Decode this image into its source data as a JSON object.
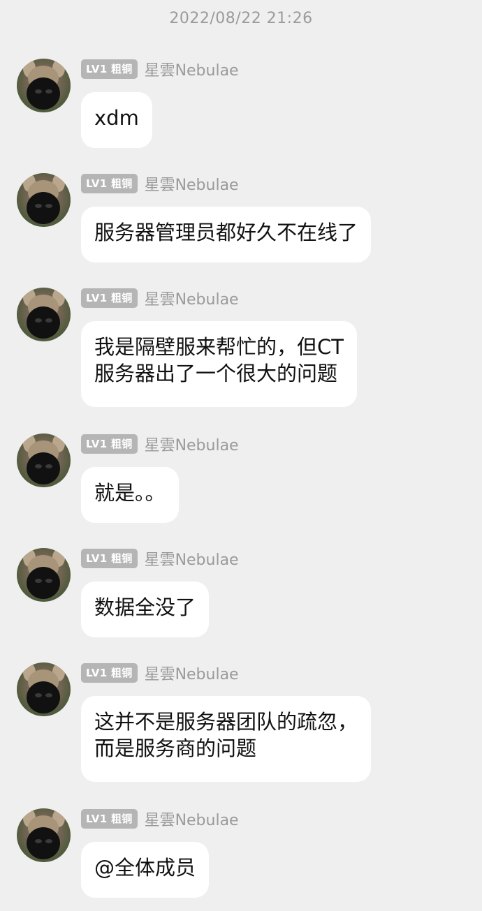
{
  "timestamp": "2022/08/22 21:26",
  "sender": {
    "badge": "LV1 粗铜",
    "nickname": "星雲Nebulae",
    "avatar_icon": "dog-nose-avatar"
  },
  "messages": [
    {
      "text": "xdm"
    },
    {
      "text": "服务器管理员都好久不在线了"
    },
    {
      "text": "我是隔壁服来帮忙的，但CT\n服务器出了一个很大的问题"
    },
    {
      "text": "就是。。"
    },
    {
      "text": "数据全没了"
    },
    {
      "text": "这并不是服务器团队的疏忽，\n而是服务商的问题"
    },
    {
      "text": "@全体成员"
    }
  ],
  "colors": {
    "background": "#efefef",
    "bubble": "#ffffff",
    "badge": "#b5b5b5",
    "meta_text": "#9a9a9a"
  }
}
